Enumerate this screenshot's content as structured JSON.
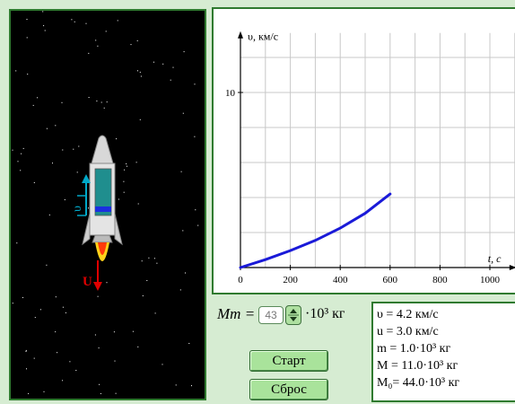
{
  "chart_data": {
    "type": "line",
    "xlabel": "t, c",
    "ylabel": "υ, км/с",
    "xlim": [
      0,
      1100
    ],
    "ylim": [
      0,
      13.4
    ],
    "x_ticks": [
      "0",
      "200",
      "400",
      "600",
      "800",
      "1000"
    ],
    "y_ticks": [
      "10"
    ],
    "grid": true,
    "series": [
      {
        "x": [
          0,
          100,
          200,
          300,
          400,
          500,
          600
        ],
        "y": [
          0,
          0.45,
          0.97,
          1.55,
          2.25,
          3.1,
          4.2
        ],
        "color": "#1a1ad8"
      }
    ]
  },
  "rocket": {
    "velocity_symbol": "υ",
    "exhaust_symbol": "U"
  },
  "controls": {
    "mt_label": "Mт =",
    "mt_value": "43",
    "mt_unit": "·10³ кг",
    "start_label": "Старт",
    "reset_label": "Сброс"
  },
  "readout": {
    "v": "υ = 4.2  км/с",
    "u": "u = 3.0  км/с",
    "m": "m = 1.0·10³ кг",
    "M": "M = 11.0·10³ кг",
    "M0": "M₀= 44.0·10³ кг"
  },
  "colors": {
    "background": "#d6ecd2",
    "frame": "#2f7a2f",
    "curve": "#1a1ad8",
    "button": "#a9e39b",
    "space": "#000000",
    "velocity_arrow": "#00a8c8",
    "exhaust_arrow": "#e00000"
  }
}
